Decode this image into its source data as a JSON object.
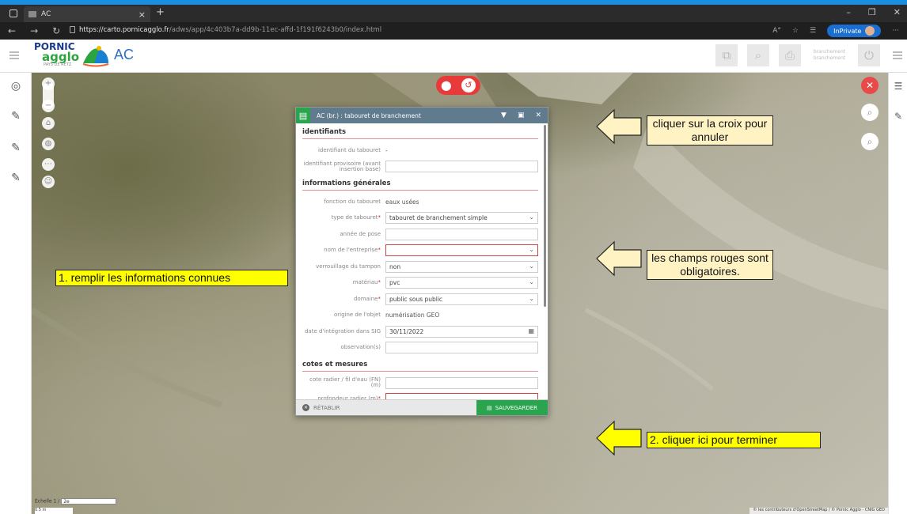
{
  "browser": {
    "tab_title": "AC",
    "url_domain": "https://carto.pornicagglo.fr",
    "url_path": "/adws/app/4c403b7a-dd9b-11ec-affd-1f191f6243b0/index.html",
    "inprivate_label": "InPrivate"
  },
  "app": {
    "logo_line1": "PORNIC",
    "logo_line2": "agglo",
    "logo_line3": "PAYS DE RETZ",
    "title": "AC",
    "branch_label": "branchement branchement"
  },
  "dialog": {
    "title": "AC (br.) : tabouret de branchement",
    "sections": [
      {
        "title": "identifiants",
        "rows": [
          {
            "label": "identifiant du tabouret",
            "value": "-",
            "kind": "text"
          },
          {
            "label": "identifiant provisoire (avant insertion base)",
            "value": "",
            "kind": "input"
          }
        ]
      },
      {
        "title": "informations générales",
        "rows": [
          {
            "label": "fonction du tabouret",
            "value": "eaux usées",
            "kind": "text"
          },
          {
            "label": "type de tabouret",
            "required": true,
            "value": "tabouret de branchement simple",
            "kind": "select"
          },
          {
            "label": "année de pose",
            "value": "",
            "kind": "input"
          },
          {
            "label": "nom de l'entreprise",
            "required": true,
            "value": "",
            "kind": "select-red"
          },
          {
            "label": "verrouillage du tampon",
            "value": "non",
            "kind": "select"
          },
          {
            "label": "matériau",
            "required": true,
            "value": "pvc",
            "kind": "select"
          },
          {
            "label": "domaine",
            "required": true,
            "value": "public sous public",
            "kind": "select"
          },
          {
            "label": "origine de l'objet",
            "value": "numérisation GEO",
            "kind": "text"
          },
          {
            "label": "date d'intégration dans SIG",
            "value": "30/11/2022",
            "kind": "date"
          },
          {
            "label": "observation(s)",
            "value": "",
            "kind": "input"
          }
        ]
      },
      {
        "title": "cotes et mesures",
        "rows": [
          {
            "label": "cote radier / fil d'eau (FN) (m)",
            "value": "",
            "kind": "input"
          },
          {
            "label": "profondeur radier (m)",
            "required": true,
            "value": "",
            "kind": "input-red"
          }
        ]
      }
    ],
    "reset_label": "RÉTABLIR",
    "save_label": "SAUVEGARDER"
  },
  "annotations": {
    "cancel_note": "cliquer sur la croix pour annuler",
    "required_note": "les champs rouges sont obligatoires.",
    "fill_note": "1. remplir les informations connues",
    "finish_note": "2. cliquer ici pour terminer"
  },
  "map": {
    "scale_label": "Échelle 1 /",
    "scale_value": "2e",
    "scale_bar": "0.5 m",
    "attribution": "© les contributeurs d'OpenStreetMap / © Pornic Agglo - CNIG GEO"
  },
  "colors": {
    "accent_green": "#2aa44f",
    "header_blue": "#607a8e",
    "required_red": "#c44444",
    "note_bg": "#fff3c4",
    "note_yellow": "#ffff00"
  }
}
